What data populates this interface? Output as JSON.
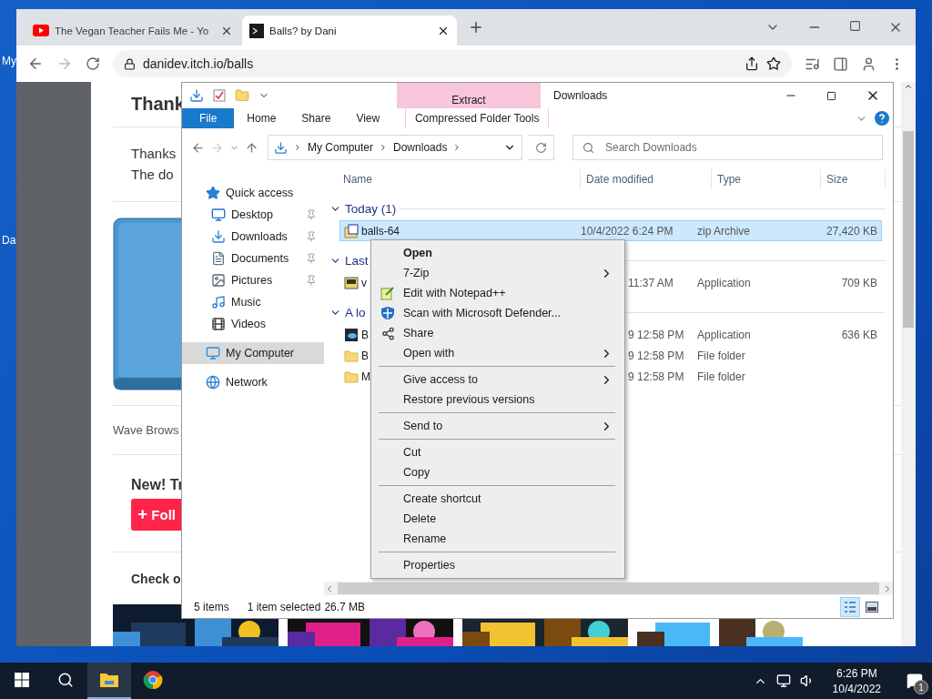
{
  "desktop": {
    "icon_labels": [
      "My",
      "Da"
    ]
  },
  "browser": {
    "tabs": [
      {
        "title": "The Vegan Teacher Fails Me - Yo",
        "kind": "video",
        "selected": false
      },
      {
        "title": "Balls? by Dani",
        "kind": "game",
        "selected": true
      }
    ],
    "url": "danidev.itch.io/balls",
    "page": {
      "heading": "Thank",
      "lines": [
        "Thanks",
        "The do"
      ],
      "note": "Wave Brows",
      "new_heading": "New! Tr",
      "follow_button": "Foll",
      "check_heading": "Check o",
      "thumbnails": [
        {
          "kind": "picture"
        },
        {
          "kind": "picture"
        },
        {
          "kind": "picture"
        },
        {
          "kind": "picture"
        }
      ]
    }
  },
  "explorer": {
    "title": "Downloads",
    "contextual_tab": "Extract",
    "ribbon_tabs": [
      {
        "label": "File",
        "kind": "file"
      },
      {
        "label": "Home",
        "kind": "plain"
      },
      {
        "label": "Share",
        "kind": "plain"
      },
      {
        "label": "View",
        "kind": "plain"
      },
      {
        "label": "Compressed Folder Tools",
        "kind": "context"
      }
    ],
    "address": [
      "My Computer",
      "Downloads"
    ],
    "search": {
      "placeholder": "Search Downloads"
    },
    "nav": [
      {
        "label": "Quick access",
        "kind": "star",
        "selected": false,
        "children": [
          {
            "label": "Desktop",
            "kind": "desktop",
            "pinned": true,
            "selected": false
          },
          {
            "label": "Downloads",
            "kind": "download",
            "pinned": true,
            "selected": false
          },
          {
            "label": "Documents",
            "kind": "document",
            "pinned": true,
            "selected": false
          },
          {
            "label": "Pictures",
            "kind": "pictures",
            "pinned": true,
            "selected": false
          },
          {
            "label": "Music",
            "kind": "music",
            "pinned": false,
            "selected": false
          },
          {
            "label": "Videos",
            "kind": "videos",
            "pinned": false,
            "selected": false
          }
        ]
      },
      {
        "label": "My Computer",
        "kind": "computer",
        "selected": true
      },
      {
        "label": "Network",
        "kind": "network",
        "selected": false
      }
    ],
    "columns": [
      "Name",
      "Date modified",
      "Type",
      "Size"
    ],
    "groups": [
      {
        "label": "Today (1)",
        "rows": [
          {
            "name": "balls-64",
            "date": "10/4/2022 6:24 PM",
            "type": "zip Archive",
            "size": "27,420 KB",
            "kind": "zip",
            "selected": true
          }
        ]
      },
      {
        "label": "Last",
        "rows": [
          {
            "name": "v",
            "date": "11:37 AM",
            "type": "Application",
            "size": "709 KB",
            "kind": "app",
            "selected": false
          }
        ]
      },
      {
        "label": "A lo",
        "rows": [
          {
            "name": "B",
            "date": "9 12:58 PM",
            "type": "Application",
            "size": "636 KB",
            "kind": "game",
            "selected": false
          },
          {
            "name": "B",
            "date": "9 12:58 PM",
            "type": "File folder",
            "kind": "folder",
            "selected": false
          },
          {
            "name": "M",
            "date": "9 12:58 PM",
            "type": "File folder",
            "kind": "folder",
            "selected": false
          }
        ]
      }
    ],
    "status": {
      "count": "5 items",
      "selection": "1 item selected",
      "size": "26.7 MB"
    },
    "view_buttons": [
      {
        "kind": "details",
        "selected": true
      },
      {
        "kind": "thumbnails",
        "selected": false
      }
    ]
  },
  "context_menu": [
    {
      "label": "Open",
      "kind": "default"
    },
    {
      "label": "7-Zip",
      "kind": "submenu"
    },
    {
      "label": "Edit with Notepad++",
      "kind": "notepad"
    },
    {
      "label": "Scan with Microsoft Defender...",
      "kind": "defender"
    },
    {
      "label": "Share",
      "kind": "share"
    },
    {
      "label": "Open with",
      "kind": "submenu"
    },
    {
      "kind": "separator"
    },
    {
      "label": "Give access to",
      "kind": "submenu"
    },
    {
      "label": "Restore previous versions",
      "kind": "item"
    },
    {
      "kind": "separator"
    },
    {
      "label": "Send to",
      "kind": "submenu"
    },
    {
      "kind": "separator"
    },
    {
      "label": "Cut",
      "kind": "item"
    },
    {
      "label": "Copy",
      "kind": "item"
    },
    {
      "kind": "separator"
    },
    {
      "label": "Create shortcut",
      "kind": "item"
    },
    {
      "label": "Delete",
      "kind": "item"
    },
    {
      "label": "Rename",
      "kind": "item"
    },
    {
      "kind": "separator"
    },
    {
      "label": "Properties",
      "kind": "item"
    }
  ],
  "taskbar": {
    "apps": [
      {
        "kind": "explorer",
        "selected": true
      },
      {
        "kind": "chrome",
        "selected": false
      }
    ],
    "time": "6:26 PM",
    "date": "10/4/2022",
    "notifications": "1"
  }
}
